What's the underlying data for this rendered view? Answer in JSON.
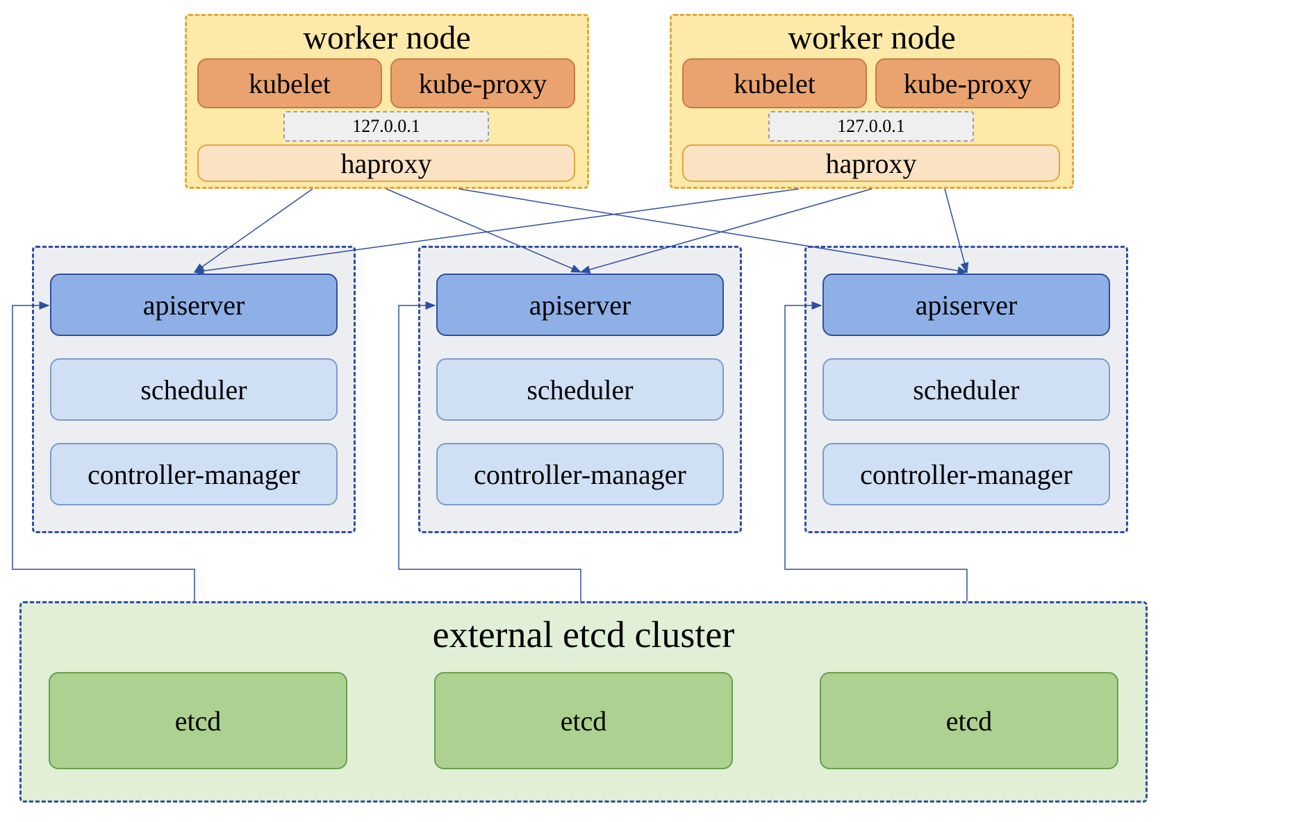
{
  "workers": [
    {
      "title": "worker node",
      "kubelet": "kubelet",
      "kube_proxy": "kube-proxy",
      "loopback": "127.0.0.1",
      "haproxy": "haproxy"
    },
    {
      "title": "worker node",
      "kubelet": "kubelet",
      "kube_proxy": "kube-proxy",
      "loopback": "127.0.0.1",
      "haproxy": "haproxy"
    }
  ],
  "control_planes": [
    {
      "apiserver": "apiserver",
      "scheduler": "scheduler",
      "controller_manager": "controller-manager"
    },
    {
      "apiserver": "apiserver",
      "scheduler": "scheduler",
      "controller_manager": "controller-manager"
    },
    {
      "apiserver": "apiserver",
      "scheduler": "scheduler",
      "controller_manager": "controller-manager"
    }
  ],
  "etcd_cluster": {
    "title": "external etcd cluster",
    "nodes": [
      "etcd",
      "etcd",
      "etcd"
    ]
  },
  "colors": {
    "worker_bg": "#fde9a8",
    "worker_border": "#e0a73c",
    "orange_bg": "#eaa36f",
    "orange_border": "#c87a3f",
    "peach_bg": "#fbe2c5",
    "peach_border": "#e0a73c",
    "loopback_bg": "#efefef",
    "loopback_border": "#9e9e9e",
    "cp_bg": "#edeef2",
    "cp_border": "#2e4f9e",
    "apiserver_bg": "#8eb0e7",
    "apiserver_border": "#2e4f9e",
    "lightblue_bg": "#cfe0f5",
    "lightblue_border": "#7b9cc9",
    "etcd_bg": "#e0efd6",
    "etcd_border": "#2e4f9e",
    "etcd_node_bg": "#acd190",
    "etcd_node_border": "#6a9e4c",
    "arrow": "#2e4f9e"
  }
}
